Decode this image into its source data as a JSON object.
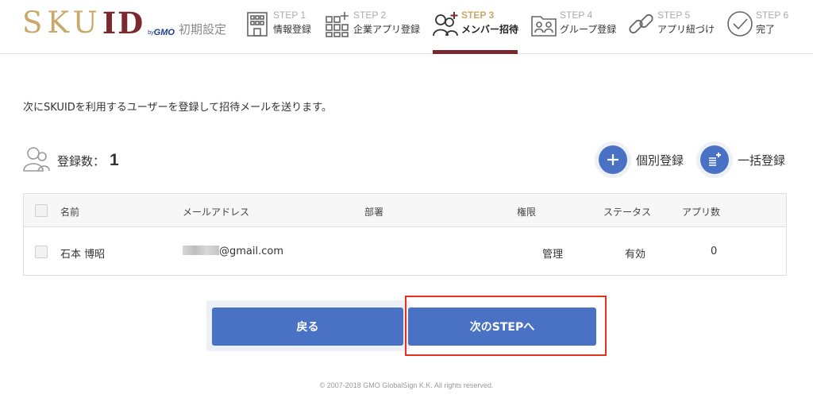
{
  "header": {
    "logo": {
      "sku": "SKU",
      "id": "ID",
      "by": "by",
      "gmo": "GMO"
    },
    "setup_title": "初期設定",
    "steps": [
      {
        "num": "STEP 1",
        "label": "情報登録",
        "icon": "building-icon"
      },
      {
        "num": "STEP 2",
        "label": "企業アプリ登録",
        "icon": "apps-grid-plus-icon"
      },
      {
        "num": "STEP 3",
        "label": "メンバー招待",
        "icon": "users-plus-icon",
        "active": true
      },
      {
        "num": "STEP 4",
        "label": "グループ登録",
        "icon": "group-folder-icon"
      },
      {
        "num": "STEP 5",
        "label": "アプリ紐づけ",
        "icon": "link-icon"
      },
      {
        "num": "STEP 6",
        "label": "完了",
        "icon": "check-circle-icon"
      }
    ],
    "active_color": "#7a2a2e"
  },
  "main": {
    "intro": "次にSKUIDを利用するユーザーを登録して招待メールを送ります。",
    "count_label": "登録数：",
    "count_value": "1",
    "actions": {
      "individual": "個別登録",
      "bulk": "一括登録"
    },
    "table": {
      "headers": {
        "name": "名前",
        "email": "メールアドレス",
        "department": "部署",
        "role": "権限",
        "status": "ステータス",
        "apps": "アプリ数"
      },
      "rows": [
        {
          "name": "石本 博昭",
          "email": "@gmail.com",
          "department": "",
          "role": "管理",
          "status": "有効",
          "apps": "0"
        }
      ]
    }
  },
  "buttons": {
    "back": "戻る",
    "next": "次のSTEPへ"
  },
  "footer": "© 2007-2018 GMO GlobalSign K.K. All rights reserved.",
  "colors": {
    "primary": "#4a72c4",
    "brand_gold": "#c9a86a",
    "brand_red": "#7a2a2e",
    "highlight": "#e0321f"
  }
}
